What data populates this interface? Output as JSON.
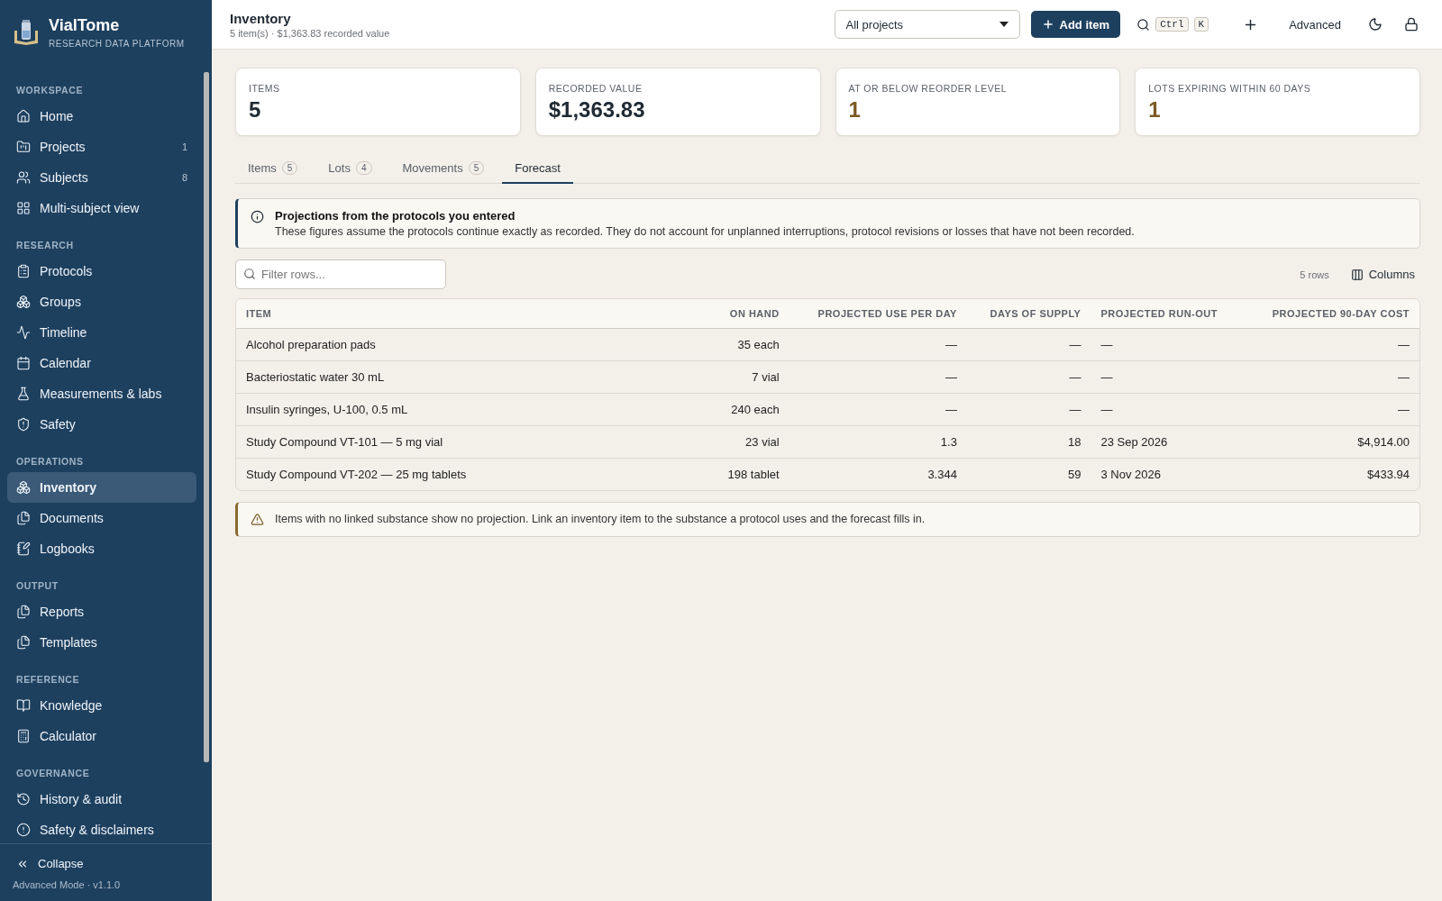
{
  "brand": {
    "name": "VialTome",
    "tagline": "RESEARCH DATA PLATFORM"
  },
  "sidebar": {
    "groups": [
      {
        "title": "WORKSPACE",
        "items": [
          {
            "label": "Home",
            "selected": false
          },
          {
            "label": "Projects",
            "count": "1",
            "selected": false
          },
          {
            "label": "Subjects",
            "count": "8",
            "selected": false
          },
          {
            "label": "Multi-subject view",
            "selected": false
          }
        ]
      },
      {
        "title": "RESEARCH",
        "items": [
          {
            "label": "Protocols",
            "selected": false
          },
          {
            "label": "Groups",
            "selected": false
          },
          {
            "label": "Timeline",
            "selected": false
          },
          {
            "label": "Calendar",
            "selected": false
          },
          {
            "label": "Measurements & labs",
            "selected": false
          },
          {
            "label": "Safety",
            "selected": false
          }
        ]
      },
      {
        "title": "OPERATIONS",
        "items": [
          {
            "label": "Inventory",
            "selected": true
          },
          {
            "label": "Documents",
            "selected": false
          },
          {
            "label": "Logbooks",
            "selected": false
          }
        ]
      },
      {
        "title": "OUTPUT",
        "items": [
          {
            "label": "Reports",
            "selected": false
          },
          {
            "label": "Templates",
            "selected": false
          }
        ]
      },
      {
        "title": "REFERENCE",
        "items": [
          {
            "label": "Knowledge",
            "selected": false
          },
          {
            "label": "Calculator",
            "selected": false
          }
        ]
      },
      {
        "title": "GOVERNANCE",
        "items": [
          {
            "label": "History & audit",
            "selected": false
          },
          {
            "label": "Safety & disclaimers",
            "selected": false
          }
        ]
      }
    ],
    "collapse": "Collapse",
    "footer": "Advanced Mode · v1.1.0"
  },
  "header": {
    "title": "Inventory",
    "subtitle": "5 item(s) · $1,363.83 recorded value",
    "project_select": "All projects",
    "add_button": "Add item",
    "shortcut_keys": [
      "Ctrl",
      "K"
    ],
    "advanced": "Advanced"
  },
  "stats": [
    {
      "label": "ITEMS",
      "value": "5",
      "warning": false
    },
    {
      "label": "RECORDED VALUE",
      "value": "$1,363.83",
      "warning": false
    },
    {
      "label": "AT OR BELOW REORDER LEVEL",
      "value": "1",
      "warning": true
    },
    {
      "label": "LOTS EXPIRING WITHIN 60 DAYS",
      "value": "1",
      "warning": true
    }
  ],
  "tabs": [
    {
      "label": "Items",
      "count": "5",
      "selected": false
    },
    {
      "label": "Lots",
      "count": "4",
      "selected": false
    },
    {
      "label": "Movements",
      "count": "5",
      "selected": false
    },
    {
      "label": "Forecast",
      "selected": true
    }
  ],
  "info": {
    "title": "Projections from the protocols you entered",
    "text": "These figures assume the protocols continue exactly as recorded. They do not account for unplanned interruptions, protocol revisions or losses that have not been recorded."
  },
  "filter": {
    "placeholder": "Filter rows..."
  },
  "row_count": "5 rows",
  "columns_button": "Columns",
  "table": {
    "columns": [
      "ITEM",
      "ON HAND",
      "PROJECTED USE PER DAY",
      "DAYS OF SUPPLY",
      "PROJECTED RUN-OUT",
      "PROJECTED 90-DAY COST"
    ],
    "rows": [
      [
        "Alcohol preparation pads",
        "35 each",
        "—",
        "—",
        "—",
        "—"
      ],
      [
        "Bacteriostatic water 30 mL",
        "7 vial",
        "—",
        "—",
        "—",
        "—"
      ],
      [
        "Insulin syringes, U-100, 0.5 mL",
        "240 each",
        "—",
        "—",
        "—",
        "—"
      ],
      [
        "Study Compound VT-101 — 5 mg vial",
        "23 vial",
        "1.3",
        "18",
        "23 Sep 2026",
        "$4,914.00"
      ],
      [
        "Study Compound VT-202 — 25 mg tablets",
        "198 tablet",
        "3.344",
        "59",
        "3 Nov 2026",
        "$433.94"
      ]
    ]
  },
  "warning_note": "Items with no linked substance show no projection. Link an inventory item to the substance a protocol uses and the forecast fills in."
}
